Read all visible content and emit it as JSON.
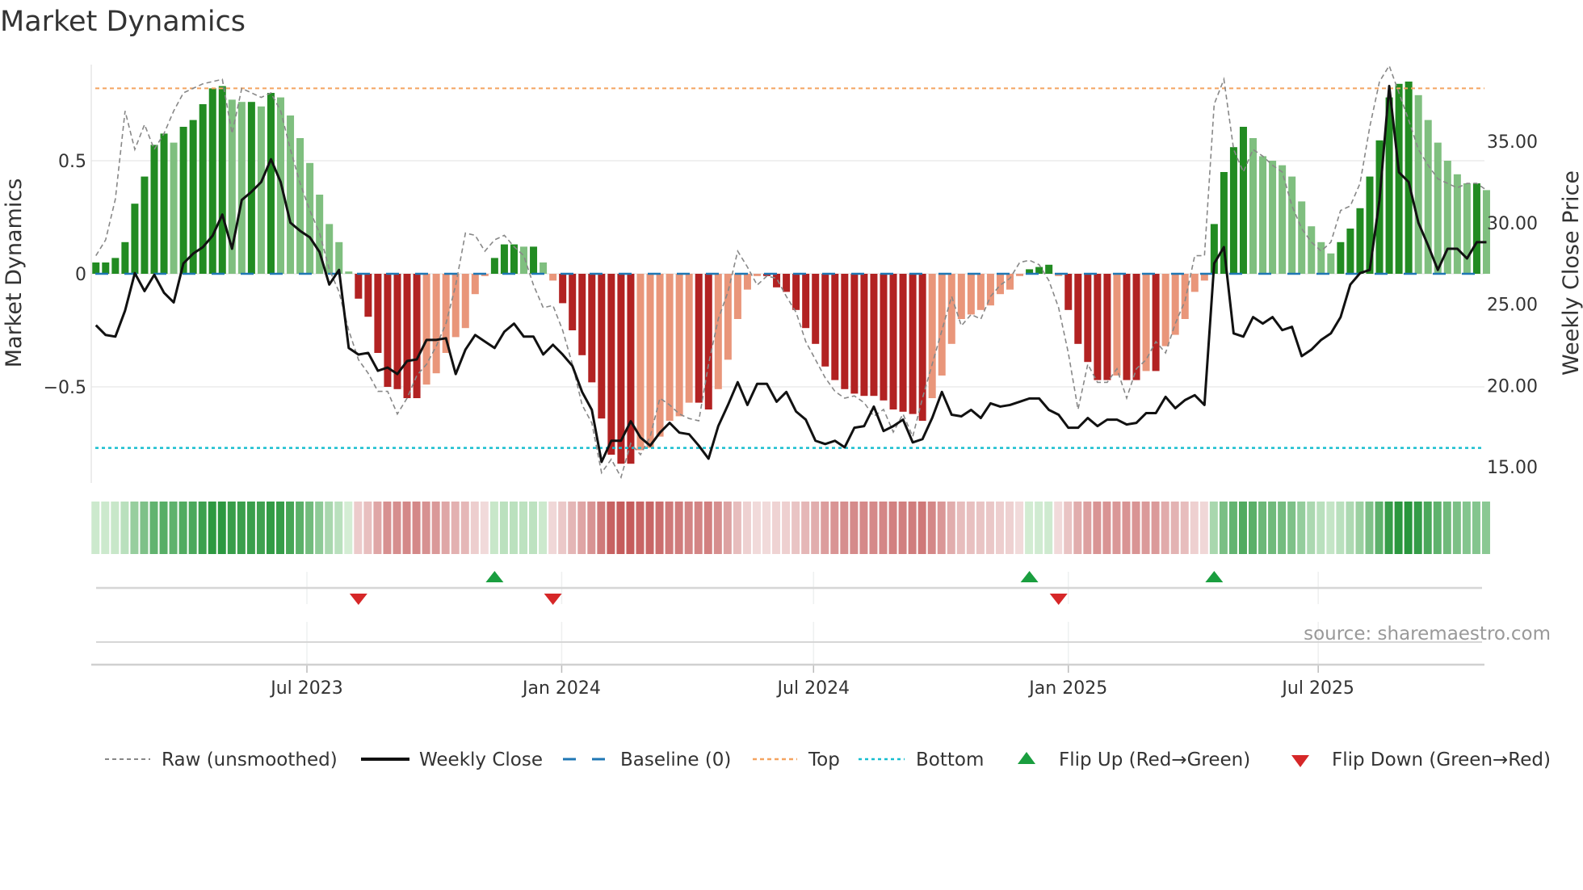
{
  "chart_data": {
    "type": "bar",
    "title": "Market Dynamics",
    "ylabel": "Market Dynamics",
    "y2label": "Weekly Close Price",
    "ylim": [
      -0.93,
      0.92
    ],
    "y2lim": [
      13.8,
      39.7
    ],
    "yticks": [
      {
        "v": 0.5,
        "label": "0.5"
      },
      {
        "v": 0,
        "label": "0"
      },
      {
        "v": -0.5,
        "label": "−0.5"
      }
    ],
    "y2ticks": [
      {
        "v": 35,
        "label": "35.00"
      },
      {
        "v": 30,
        "label": "30.00"
      },
      {
        "v": 25,
        "label": "25.00"
      },
      {
        "v": 20,
        "label": "20.00"
      },
      {
        "v": 15,
        "label": "15.00"
      }
    ],
    "xticks": [
      {
        "week": 21.7,
        "label": "Jul 2023"
      },
      {
        "week": 47.9,
        "label": "Jan 2024"
      },
      {
        "week": 73.8,
        "label": "Jul 2024"
      },
      {
        "week": 100,
        "label": "Jan 2025"
      },
      {
        "week": 125.7,
        "label": "Jul 2025"
      }
    ],
    "top_level": 0.82,
    "bottom_level": -0.77,
    "baseline": 0,
    "momentum": [
      0.05,
      0.05,
      0.07,
      0.14,
      0.31,
      0.43,
      0.57,
      0.62,
      0.58,
      0.65,
      0.68,
      0.75,
      0.82,
      0.83,
      0.77,
      0.76,
      0.76,
      0.74,
      0.8,
      0.78,
      0.7,
      0.6,
      0.49,
      0.35,
      0.22,
      0.14,
      0.01,
      -0.11,
      -0.19,
      -0.35,
      -0.5,
      -0.51,
      -0.55,
      -0.55,
      -0.49,
      -0.44,
      -0.35,
      -0.28,
      -0.24,
      -0.09,
      -0.01,
      0.07,
      0.13,
      0.13,
      0.12,
      0.12,
      0.05,
      -0.03,
      -0.13,
      -0.25,
      -0.36,
      -0.48,
      -0.64,
      -0.8,
      -0.84,
      -0.84,
      -0.78,
      -0.77,
      -0.72,
      -0.65,
      -0.63,
      -0.57,
      -0.57,
      -0.6,
      -0.51,
      -0.38,
      -0.2,
      -0.07,
      -0.01,
      -0.01,
      -0.06,
      -0.08,
      -0.16,
      -0.24,
      -0.31,
      -0.41,
      -0.47,
      -0.51,
      -0.53,
      -0.54,
      -0.54,
      -0.56,
      -0.6,
      -0.61,
      -0.62,
      -0.65,
      -0.55,
      -0.45,
      -0.31,
      -0.2,
      -0.18,
      -0.16,
      -0.14,
      -0.09,
      -0.07,
      -0.01,
      0.02,
      0.03,
      0.04,
      -0.01,
      -0.16,
      -0.31,
      -0.39,
      -0.47,
      -0.47,
      -0.45,
      -0.47,
      -0.47,
      -0.43,
      -0.43,
      -0.32,
      -0.27,
      -0.2,
      -0.08,
      -0.03,
      0.22,
      0.45,
      0.56,
      0.65,
      0.6,
      0.52,
      0.5,
      0.48,
      0.43,
      0.32,
      0.21,
      0.14,
      0.09,
      0.14,
      0.2,
      0.29,
      0.43,
      0.59,
      0.78,
      0.84,
      0.85,
      0.79,
      0.68,
      0.58,
      0.5,
      0.44,
      0.4,
      0.4,
      0.37
    ],
    "raw": [
      0.08,
      0.15,
      0.33,
      0.72,
      0.55,
      0.66,
      0.55,
      0.62,
      0.72,
      0.8,
      0.82,
      0.84,
      0.85,
      0.86,
      0.62,
      0.82,
      0.8,
      0.78,
      0.8,
      0.72,
      0.55,
      0.4,
      0.28,
      0.18,
      0.02,
      -0.08,
      -0.25,
      -0.38,
      -0.44,
      -0.52,
      -0.52,
      -0.62,
      -0.55,
      -0.45,
      -0.4,
      -0.32,
      -0.22,
      -0.05,
      0.18,
      0.17,
      0.1,
      0.15,
      0.17,
      0.12,
      0.08,
      -0.05,
      -0.15,
      -0.14,
      -0.25,
      -0.4,
      -0.58,
      -0.66,
      -0.88,
      -0.82,
      -0.9,
      -0.75,
      -0.8,
      -0.72,
      -0.55,
      -0.58,
      -0.62,
      -0.64,
      -0.65,
      -0.4,
      -0.2,
      -0.08,
      0.1,
      0.03,
      -0.05,
      -0.01,
      -0.02,
      -0.1,
      -0.17,
      -0.3,
      -0.38,
      -0.46,
      -0.52,
      -0.55,
      -0.54,
      -0.57,
      -0.63,
      -0.6,
      -0.7,
      -0.62,
      -0.72,
      -0.55,
      -0.4,
      -0.25,
      -0.1,
      -0.23,
      -0.18,
      -0.2,
      -0.1,
      -0.05,
      -0.02,
      0.05,
      0.06,
      0.04,
      -0.03,
      -0.15,
      -0.35,
      -0.6,
      -0.4,
      -0.48,
      -0.48,
      -0.42,
      -0.55,
      -0.42,
      -0.38,
      -0.3,
      -0.35,
      -0.22,
      -0.12,
      0.08,
      0.08,
      0.75,
      0.86,
      0.55,
      0.45,
      0.55,
      0.52,
      0.48,
      0.45,
      0.3,
      0.2,
      0.14,
      0.1,
      0.14,
      0.28,
      0.3,
      0.4,
      0.65,
      0.85,
      0.92,
      0.8,
      0.68,
      0.55,
      0.48,
      0.42,
      0.4,
      0.38,
      0.4,
      0.4,
      0.37
    ],
    "weekly_close": [
      23.7,
      23.1,
      23.0,
      24.6,
      26.9,
      25.8,
      26.8,
      25.7,
      25.1,
      27.5,
      28.1,
      28.5,
      29.2,
      30.5,
      28.4,
      31.4,
      31.9,
      32.5,
      33.9,
      32.5,
      30.0,
      29.5,
      29.1,
      28.2,
      26.2,
      27.1,
      22.3,
      21.9,
      22.0,
      20.9,
      21.1,
      20.7,
      21.5,
      21.6,
      22.8,
      22.8,
      22.9,
      20.7,
      22.2,
      23.1,
      22.7,
      22.3,
      23.3,
      23.8,
      23.0,
      23.0,
      21.9,
      22.5,
      21.9,
      21.2,
      19.6,
      18.5,
      15.3,
      16.6,
      16.6,
      17.8,
      16.8,
      16.3,
      17.1,
      17.7,
      17.1,
      17.0,
      16.3,
      15.5,
      17.5,
      18.8,
      20.2,
      18.8,
      20.1,
      20.1,
      19.0,
      19.6,
      18.4,
      17.9,
      16.6,
      16.4,
      16.6,
      16.2,
      17.4,
      17.5,
      18.7,
      17.2,
      17.5,
      17.9,
      16.5,
      16.7,
      18.0,
      19.6,
      18.2,
      18.1,
      18.5,
      18.0,
      18.9,
      18.7,
      18.8,
      19.0,
      19.2,
      19.2,
      18.5,
      18.2,
      17.4,
      17.4,
      18.0,
      17.5,
      17.9,
      17.9,
      17.6,
      17.7,
      18.3,
      18.3,
      19.3,
      18.6,
      19.1,
      19.4,
      18.8,
      27.5,
      28.5,
      23.2,
      23.0,
      24.2,
      23.8,
      24.2,
      23.4,
      23.6,
      21.8,
      22.2,
      22.8,
      23.2,
      24.2,
      26.2,
      26.9,
      27.1,
      31.4,
      38.4,
      33.1,
      32.5,
      30.0,
      28.6,
      27.1,
      28.4,
      28.4,
      27.8,
      28.8,
      28.8
    ],
    "flip_up_weeks": [
      41,
      96,
      115
    ],
    "flip_down_weeks": [
      27,
      47,
      99
    ],
    "legend": {
      "placement": "bottom",
      "items": [
        {
          "key": "raw",
          "label": "Raw (unsmoothed)"
        },
        {
          "key": "close",
          "label": "Weekly Close"
        },
        {
          "key": "baseline",
          "label": "Baseline (0)"
        },
        {
          "key": "top",
          "label": "Top"
        },
        {
          "key": "bottom",
          "label": "Bottom"
        },
        {
          "key": "flipup",
          "label": "Flip Up (Red→Green)"
        },
        {
          "key": "flipdown",
          "label": "Flip Down (Green→Red)"
        }
      ]
    },
    "annotation": "source: sharemaestro.com",
    "colors": {
      "green_strong": "#228b22",
      "green_weak": "#7fbf7f",
      "red_strong": "#b22222",
      "red_weak": "#e9967a",
      "raw": "#888888",
      "close": "#111111",
      "baseline": "#1f77b4",
      "top": "#f4a460",
      "bottom": "#17becf",
      "flip_up": "#1a9e3f",
      "flip_down": "#d62728"
    }
  }
}
